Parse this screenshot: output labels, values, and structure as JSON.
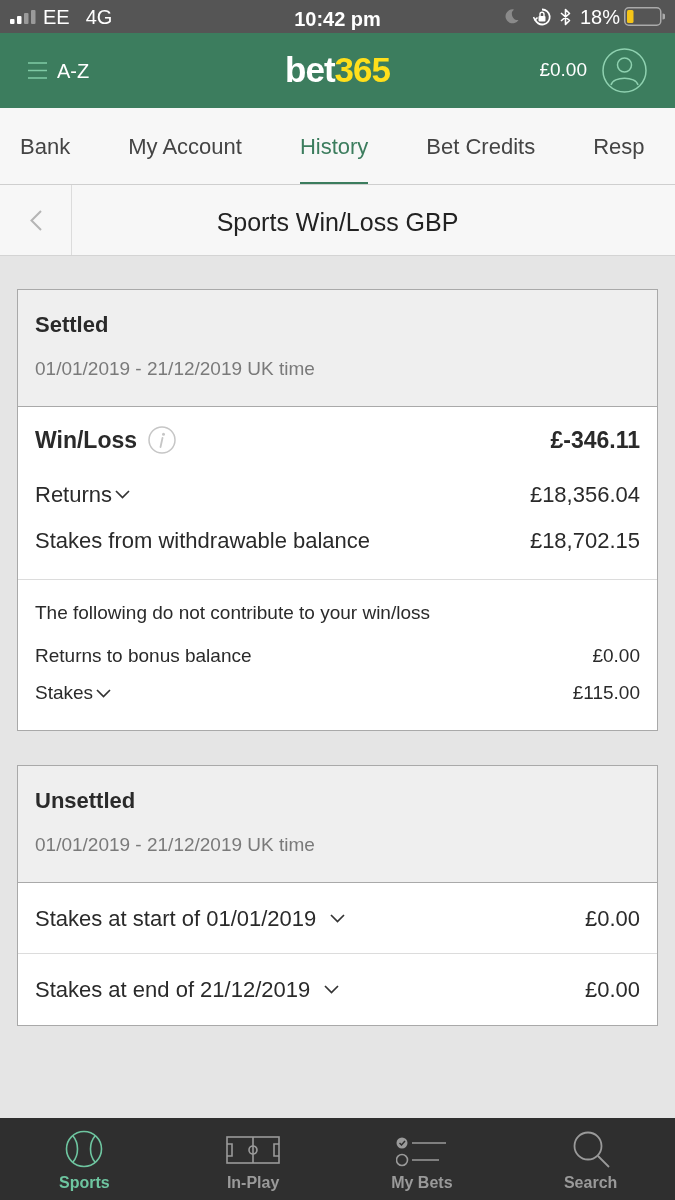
{
  "status_bar": {
    "carrier": "EE",
    "network": "4G",
    "time": "10:42 pm",
    "battery": "18%"
  },
  "header": {
    "menu_label": "A-Z",
    "logo": [
      "bet",
      "365"
    ],
    "balance": "£0.00"
  },
  "tabs": [
    {
      "label": "Bank",
      "selected": false
    },
    {
      "label": "My Account",
      "selected": false
    },
    {
      "label": "History",
      "selected": true
    },
    {
      "label": "Bet Credits",
      "selected": false
    },
    {
      "label": "Resp",
      "selected": false
    }
  ],
  "page_title": "Sports Win/Loss GBP",
  "sections": [
    {
      "title": "Settled",
      "period": "01/01/2019 - 21/12/2019 UK time",
      "rows": [
        {
          "kind": "total",
          "label": "Win/Loss",
          "value": "£-346.11"
        },
        {
          "kind": "expandable",
          "label": "Returns",
          "value": "£18,356.04"
        },
        {
          "kind": "plain",
          "label": "Stakes from withdrawable balance",
          "value": "£18,702.15"
        }
      ],
      "note": {
        "text": "The following do not contribute to your win/loss",
        "rows": [
          {
            "kind": "plain",
            "label": "Returns to bonus balance",
            "value": "£0.00"
          },
          {
            "kind": "expandable",
            "label": "Stakes",
            "value": "£115.00"
          }
        ]
      }
    },
    {
      "title": "Unsettled",
      "period": "01/01/2019 - 21/12/2019 UK time",
      "rows": [
        {
          "kind": "divided",
          "label": "Stakes at start of 01/01/2019",
          "value": "£0.00"
        },
        {
          "kind": "divided",
          "label": "Stakes at end of 21/12/2019",
          "value": "£0.00"
        }
      ]
    }
  ],
  "bottom_nav": [
    {
      "label": "Sports",
      "selected": true
    },
    {
      "label": "In-Play",
      "selected": false
    },
    {
      "label": "My Bets",
      "selected": false
    },
    {
      "label": "Search",
      "selected": false
    }
  ]
}
